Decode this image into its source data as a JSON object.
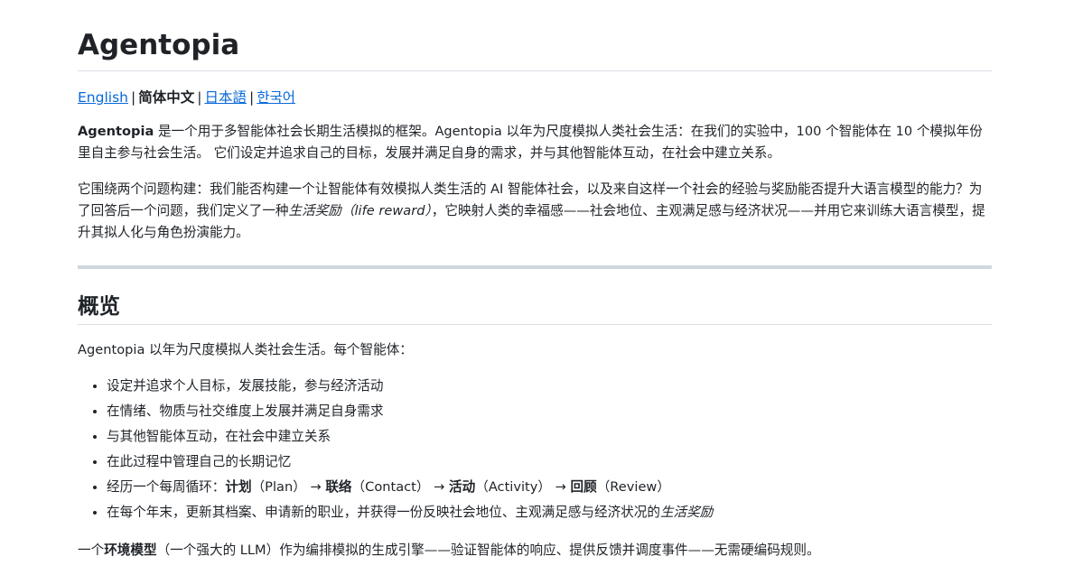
{
  "title": "Agentopia",
  "languages": {
    "english": "English",
    "simplified_chinese": "简体中文",
    "japanese": "日本語",
    "korean": "한국어",
    "separator": "|"
  },
  "intro": {
    "p1_name": "Agentopia",
    "p1_rest": " 是一个用于多智能体社会长期生活模拟的框架。Agentopia 以年为尺度模拟人类社会生活：在我们的实验中，100 个智能体在 10 个模拟年份里自主参与社会生活。 它们设定并追求自己的目标，发展并满足自身的需求，并与其他智能体互动，在社会中建立关系。",
    "p2_before": "它围绕两个问题构建：我们能否构建一个让智能体有效模拟人类生活的 AI 智能体社会，以及来自这样一个社会的经验与奖励能否提升大语言模型的能力？为了回答后一个问题，我们定义了一种",
    "p2_em": "生活奖励（life reward）",
    "p2_after": "，它映射人类的幸福感——社会地位、主观满足感与经济状况——并用它来训练大语言模型，提升其拟人化与角色扮演能力。"
  },
  "overview": {
    "heading": "概览",
    "lead": "Agentopia 以年为尺度模拟人类社会生活。每个智能体：",
    "items": [
      "设定并追求个人目标，发展技能，参与经济活动",
      "在情绪、物质与社交维度上发展并满足自身需求",
      "与其他智能体互动，在社会中建立关系",
      "在此过程中管理自己的长期记忆"
    ],
    "cycle": {
      "prefix": "经历一个每周循环：",
      "plan": "计划",
      "plan_en": "（Plan）",
      "arrow": " → ",
      "contact": "联络",
      "contact_en": "（Contact）",
      "activity": "活动",
      "activity_en": "（Activity）",
      "review": "回顾",
      "review_en": "（Review）"
    },
    "yearend": {
      "text": "在每个年末，更新其档案、申请新的职业，并获得一份反映社会地位、主观满足感与经济状况的",
      "em": "生活奖励"
    },
    "env": {
      "prefix": "一个",
      "strong": "环境模型",
      "rest": "（一个强大的 LLM）作为编排模拟的生成引擎——验证智能体的响应、提供反馈并调度事件——无需硬编码规则。"
    }
  }
}
